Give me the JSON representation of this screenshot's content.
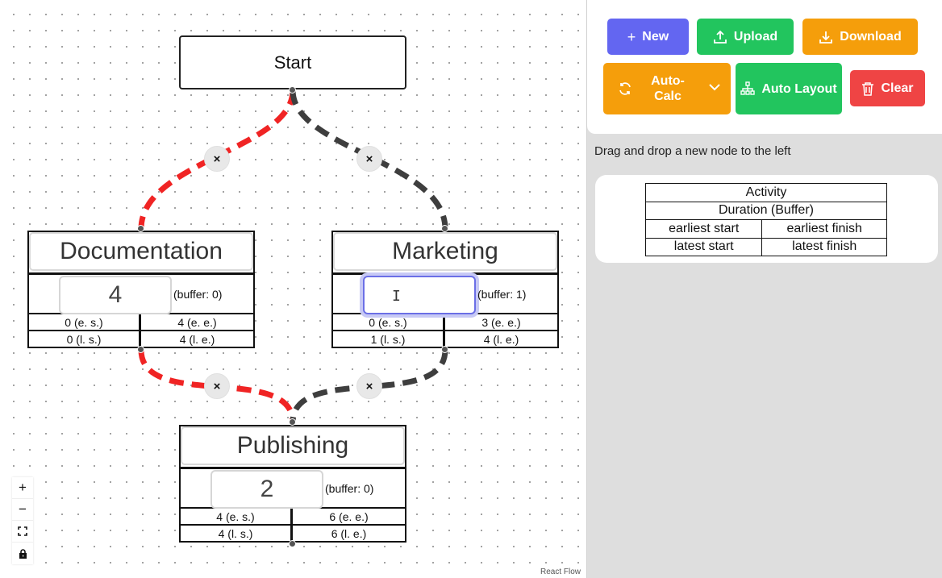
{
  "canvas": {
    "start_node": {
      "label": "Start"
    },
    "activities": [
      {
        "id": "documentation",
        "title": "Documentation",
        "duration": "4",
        "buffer": "(buffer: 0)",
        "es": "0 (e. s.)",
        "ee": "4 (e. e.)",
        "ls": "0 (l. s.)",
        "le": "4 (l. e.)"
      },
      {
        "id": "marketing",
        "title": "Marketing",
        "duration": "",
        "buffer": "(buffer: 1)",
        "es": "0 (e. s.)",
        "ee": "3 (e. e.)",
        "ls": "1 (l. s.)",
        "le": "4 (l. e.)"
      },
      {
        "id": "publishing",
        "title": "Publishing",
        "duration": "2",
        "buffer": "(buffer: 0)",
        "es": "4 (e. s.)",
        "ee": "6 (e. e.)",
        "ls": "4 (l. s.)",
        "le": "6 (l. e.)"
      }
    ],
    "edge_delete_symbol": "×",
    "edge_colors": {
      "critical": "#f02424",
      "normal": "#3e3e3e"
    },
    "controls": {
      "zoom_in": "+",
      "zoom_out": "−",
      "fit_view": "⛶",
      "lock": "🔒"
    },
    "attribution": "React Flow"
  },
  "sidebar": {
    "buttons": {
      "new": "New",
      "upload": "Upload",
      "download": "Download",
      "auto_calc": "Auto-Calc",
      "auto_layout": "Auto Layout",
      "clear": "Clear"
    },
    "colors": {
      "new": "#6366f1",
      "upload": "#22c55e",
      "download": "#f59e0b",
      "auto_calc": "#f59e0b",
      "auto_layout": "#22c55e",
      "clear": "#ef4444"
    },
    "hint": "Drag and drop a new node to the left",
    "legend": {
      "activity": "Activity",
      "duration": "Duration (Buffer)",
      "earliest_start": "earliest start",
      "earliest_finish": "earliest finish",
      "latest_start": "latest start",
      "latest_finish": "latest finish"
    }
  }
}
